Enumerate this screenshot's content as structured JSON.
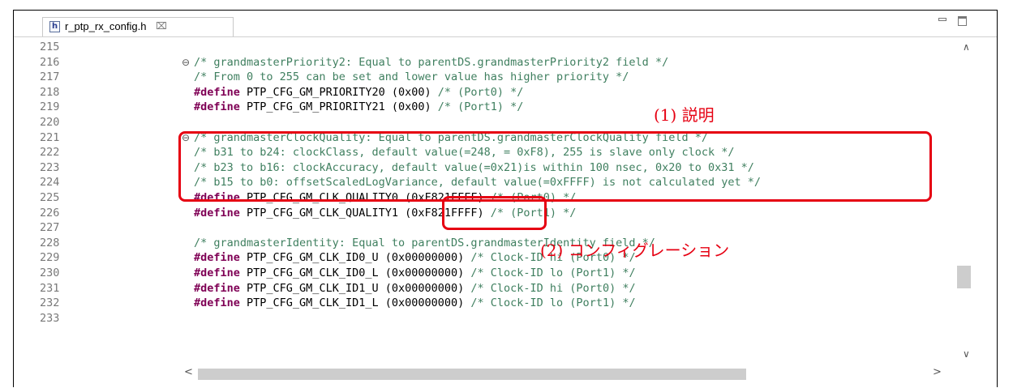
{
  "tab": {
    "file_icon_letter": "h",
    "title": "r_ptp_rx_config.h",
    "close_glyph": "⌧",
    "icon": "header-file-icon"
  },
  "window_controls": {
    "minimize_icon": "minimize-icon",
    "maximize_icon": "maximize-icon"
  },
  "lines": [
    {
      "num": "215",
      "fold": "",
      "parts": []
    },
    {
      "num": "216",
      "fold": "⊖",
      "parts": [
        {
          "t": "cm",
          "v": "/* grandmasterPriority2: Equal to parentDS.grandmasterPriority2 field */"
        }
      ]
    },
    {
      "num": "217",
      "fold": "",
      "parts": [
        {
          "t": "cm",
          "v": "/* From 0 to 255 can be set and lower value has higher priority */"
        }
      ]
    },
    {
      "num": "218",
      "fold": "",
      "parts": [
        {
          "t": "kw",
          "v": "#define"
        },
        {
          "t": "tx",
          "v": " PTP_CFG_GM_PRIORITY20 (0x00) "
        },
        {
          "t": "cm",
          "v": "/* (Port0) */"
        }
      ]
    },
    {
      "num": "219",
      "fold": "",
      "parts": [
        {
          "t": "kw",
          "v": "#define"
        },
        {
          "t": "tx",
          "v": " PTP_CFG_GM_PRIORITY21 (0x00) "
        },
        {
          "t": "cm",
          "v": "/* (Port1) */"
        }
      ]
    },
    {
      "num": "220",
      "fold": "",
      "parts": []
    },
    {
      "num": "221",
      "fold": "⊖",
      "parts": [
        {
          "t": "cm",
          "v": "/* grandmasterClockQuality: Equal to parentDS.grandmasterClockQuality field */"
        }
      ]
    },
    {
      "num": "222",
      "fold": "",
      "parts": [
        {
          "t": "cm",
          "v": "/* b31 to b24: clockClass, default value(=248, = 0xF8), 255 is slave only clock */"
        }
      ]
    },
    {
      "num": "223",
      "fold": "",
      "parts": [
        {
          "t": "cm",
          "v": "/* b23 to b16: clockAccuracy, default value(=0x21)is within 100 nsec, 0x20 to 0x31 */"
        }
      ]
    },
    {
      "num": "224",
      "fold": "",
      "parts": [
        {
          "t": "cm",
          "v": "/* b15 to b0: offsetScaledLogVariance, default value(=0xFFFF) is not calculated yet */"
        }
      ]
    },
    {
      "num": "225",
      "fold": "",
      "parts": [
        {
          "t": "kw",
          "v": "#define"
        },
        {
          "t": "tx",
          "v": " PTP_CFG_GM_CLK_QUALITY0 (0xF821FFFF) "
        },
        {
          "t": "cm",
          "v": "/* (Port0) */"
        }
      ]
    },
    {
      "num": "226",
      "fold": "",
      "parts": [
        {
          "t": "kw",
          "v": "#define"
        },
        {
          "t": "tx",
          "v": " PTP_CFG_GM_CLK_QUALITY1 (0xF821FFFF) "
        },
        {
          "t": "cm",
          "v": "/* (Port1) */"
        }
      ]
    },
    {
      "num": "227",
      "fold": "",
      "parts": []
    },
    {
      "num": "228",
      "fold": "",
      "parts": [
        {
          "t": "cm",
          "v": "/* grandmasterIdentity: Equal to parentDS.grandmasterIdentity field */"
        }
      ]
    },
    {
      "num": "229",
      "fold": "",
      "parts": [
        {
          "t": "kw",
          "v": "#define"
        },
        {
          "t": "tx",
          "v": " PTP_CFG_GM_CLK_ID0_U (0x00000000) "
        },
        {
          "t": "cm",
          "v": "/* Clock-ID hi (Port0) */"
        }
      ]
    },
    {
      "num": "230",
      "fold": "",
      "parts": [
        {
          "t": "kw",
          "v": "#define"
        },
        {
          "t": "tx",
          "v": " PTP_CFG_GM_CLK_ID0_L (0x00000000) "
        },
        {
          "t": "cm",
          "v": "/* Clock-ID lo (Port1) */"
        }
      ]
    },
    {
      "num": "231",
      "fold": "",
      "parts": [
        {
          "t": "kw",
          "v": "#define"
        },
        {
          "t": "tx",
          "v": " PTP_CFG_GM_CLK_ID1_U (0x00000000) "
        },
        {
          "t": "cm",
          "v": "/* Clock-ID hi (Port0) */"
        }
      ]
    },
    {
      "num": "232",
      "fold": "",
      "parts": [
        {
          "t": "kw",
          "v": "#define"
        },
        {
          "t": "tx",
          "v": " PTP_CFG_GM_CLK_ID1_L (0x00000000) "
        },
        {
          "t": "cm",
          "v": "/* Clock-ID lo (Port1) */"
        }
      ]
    },
    {
      "num": "233",
      "fold": "",
      "parts": []
    }
  ],
  "scrollbars": {
    "up_glyph": "∧",
    "down_glyph": "∨",
    "left_glyph": "<",
    "right_glyph": ">"
  },
  "annotations": {
    "label1": "(1) 説明",
    "label2": "(2) コンフィグレーション",
    "color": "#e60012"
  },
  "colors": {
    "comment": "#3f7f5f",
    "keyword": "#7f0055",
    "line_number": "#787878"
  }
}
